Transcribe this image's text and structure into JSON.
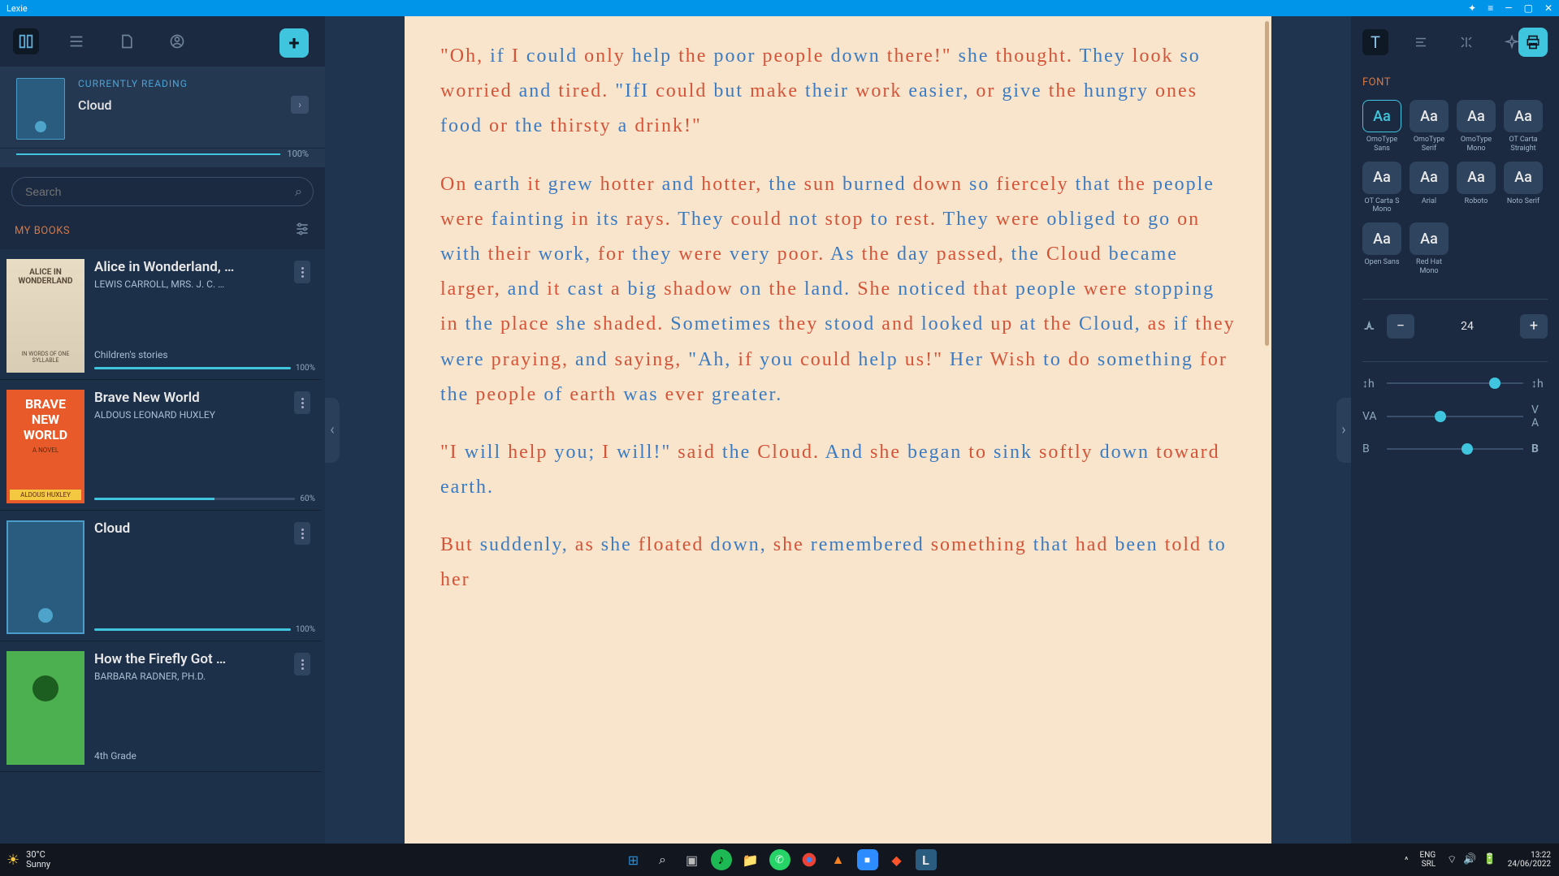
{
  "window": {
    "title": "Lexie"
  },
  "sidebar": {
    "currently_reading_label": "CURRENTLY READING",
    "current_title": "Cloud",
    "current_progress": "100%",
    "search_placeholder": "Search",
    "my_books_label": "MY BOOKS",
    "books": [
      {
        "title": "Alice in Wonderland, …",
        "author": "LEWIS CARROLL, MRS. J. C. …",
        "tag": "Children's stories",
        "progress_text": "100%",
        "progress_pct": 100
      },
      {
        "title": "Brave New World",
        "author": "ALDOUS LEONARD HUXLEY",
        "tag": "",
        "progress_text": "60%",
        "progress_pct": 60
      },
      {
        "title": "Cloud",
        "author": "",
        "tag": "",
        "progress_text": "100%",
        "progress_pct": 100
      },
      {
        "title": "How the Firefly Got …",
        "author": "BARBARA RADNER, PH.D.",
        "tag": "4th Grade",
        "progress_text": "",
        "progress_pct": 0
      }
    ]
  },
  "reader": {
    "paragraphs": [
      "\"Oh, if I could only help the poor people down there!\" she thought. They look so worried and tired. \"IfI could but make their work easier, or give the hungry ones food or the thirsty a drink!\"",
      "On earth it grew hotter and hotter, the sun burned down so fiercely that the people were fainting in its rays. They could not stop to rest. They were obliged to go on with their work, for they were very poor. As the day passed, the Cloud became larger, and it cast a big shadow on the land. She noticed that people were stopping in the place she shaded. Sometimes they stood and looked up at the Cloud, as if they were praying, and saying, \"Ah, if you could help us!\" Her Wish to do something for the people of earth was ever greater.",
      "\"I will help you; I will!\" said the Cloud. And she began to sink softly down toward earth.",
      "But suddenly, as she floated down, she remembered something that had been told to her"
    ]
  },
  "right_panel": {
    "font_heading": "FONT",
    "fonts": [
      {
        "sample": "Aa",
        "label": "OmoType Sans",
        "selected": true
      },
      {
        "sample": "Aa",
        "label": "OmoType Serif",
        "selected": false
      },
      {
        "sample": "Aa",
        "label": "OmoType Mono",
        "selected": false
      },
      {
        "sample": "Aa",
        "label": "OT Carta Straight",
        "selected": false
      },
      {
        "sample": "Aa",
        "label": "OT Carta S Mono",
        "selected": false
      },
      {
        "sample": "Aa",
        "label": "Arial",
        "selected": false
      },
      {
        "sample": "Aa",
        "label": "Roboto",
        "selected": false
      },
      {
        "sample": "Aa",
        "label": "Noto Serif",
        "selected": false
      },
      {
        "sample": "Aa",
        "label": "Open Sans",
        "selected": false
      },
      {
        "sample": "Aa",
        "label": "Red Hat Mono",
        "selected": false
      }
    ],
    "font_size": "24",
    "sliders": {
      "line_height_pct": 75,
      "letter_spacing_pct": 35,
      "boldness_pct": 55
    }
  },
  "taskbar": {
    "temp": "30°C",
    "weather": "Sunny",
    "lang1": "ENG",
    "lang2": "SRL",
    "time": "13:22",
    "date": "24/06/2022"
  },
  "covers": {
    "alice_top": "ALICE IN WONDERLAND",
    "alice_bottom": "IN WORDS OF ONE SYLLABLE",
    "brave_title": "BRAVE NEW WORLD",
    "brave_sub": "A NOVEL",
    "brave_author": "ALDOUS HUXLEY"
  }
}
